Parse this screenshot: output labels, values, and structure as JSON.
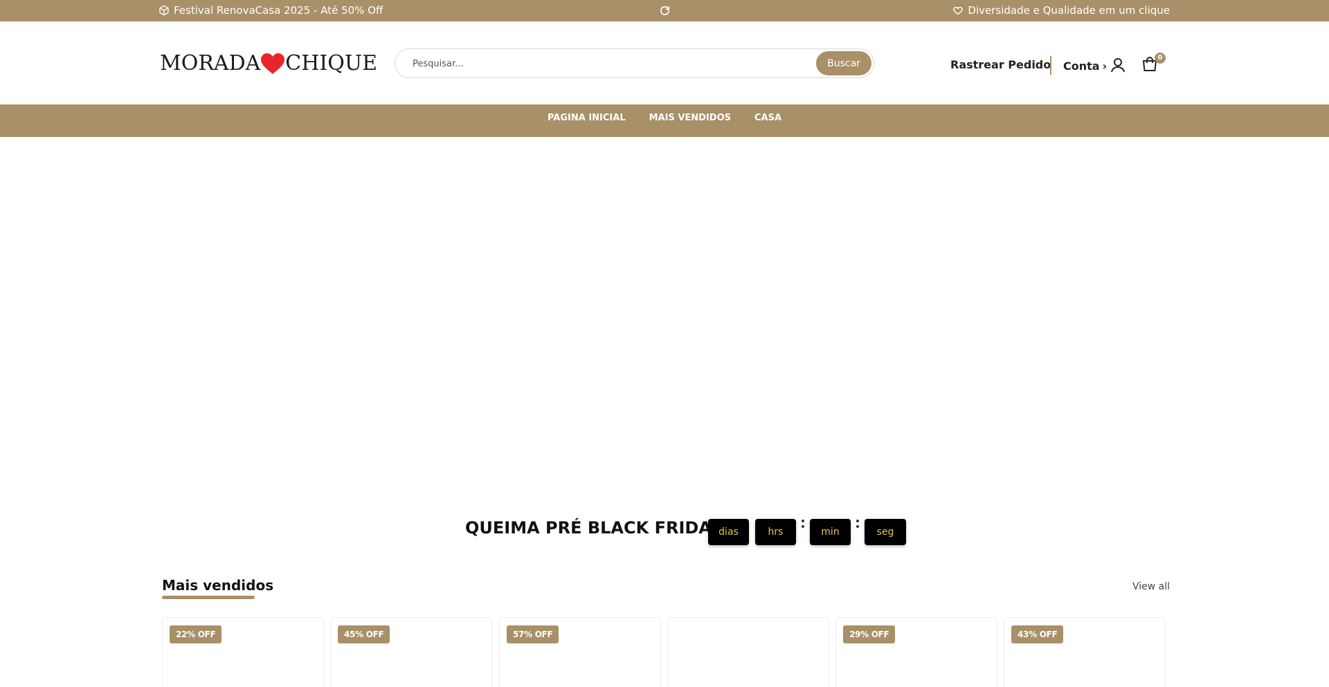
{
  "announcement": {
    "left_icon": "box-icon",
    "left_text": "Festival RenovaCasa 2025 - Até 50% Off",
    "mid_icon": "refresh-icon",
    "right_icon": "heart-outline-icon",
    "right_text": "Diversidade e Qualidade em um clique"
  },
  "header": {
    "logo_left": "MORADA",
    "logo_heart_color": "#e8262a",
    "logo_right": "CHIQUE",
    "search": {
      "placeholder": "Pesquisar...",
      "value": "",
      "button_label": "Buscar",
      "icon": "search-icon"
    },
    "track_order": "Rastrear Pedido",
    "account_label": "Conta",
    "account_chevron": "›",
    "account_icon": "user-icon",
    "cart_icon": "cart-icon",
    "cart_count": "0"
  },
  "nav": {
    "items": [
      {
        "label": "PAGINA INICIAL"
      },
      {
        "label": "MAIS VENDIDOS"
      },
      {
        "label": "CASA"
      }
    ]
  },
  "countdown": {
    "title": "QUEIMA PRÉ BLACK FRIDAY",
    "units": [
      {
        "label": "dias"
      },
      {
        "label": "hrs"
      },
      {
        "label": "min"
      },
      {
        "label": "seg"
      }
    ]
  },
  "best_sellers": {
    "title": "Mais vendidos",
    "view_all": "View all",
    "products": [
      {
        "discount": "22% OFF"
      },
      {
        "discount": "45% OFF"
      },
      {
        "discount": "57% OFF"
      },
      {
        "discount": ""
      },
      {
        "discount": "29% OFF"
      },
      {
        "discount": "43% OFF"
      }
    ]
  },
  "colors": {
    "brand": "#a89068",
    "countdown_text": "#e6c84a"
  }
}
